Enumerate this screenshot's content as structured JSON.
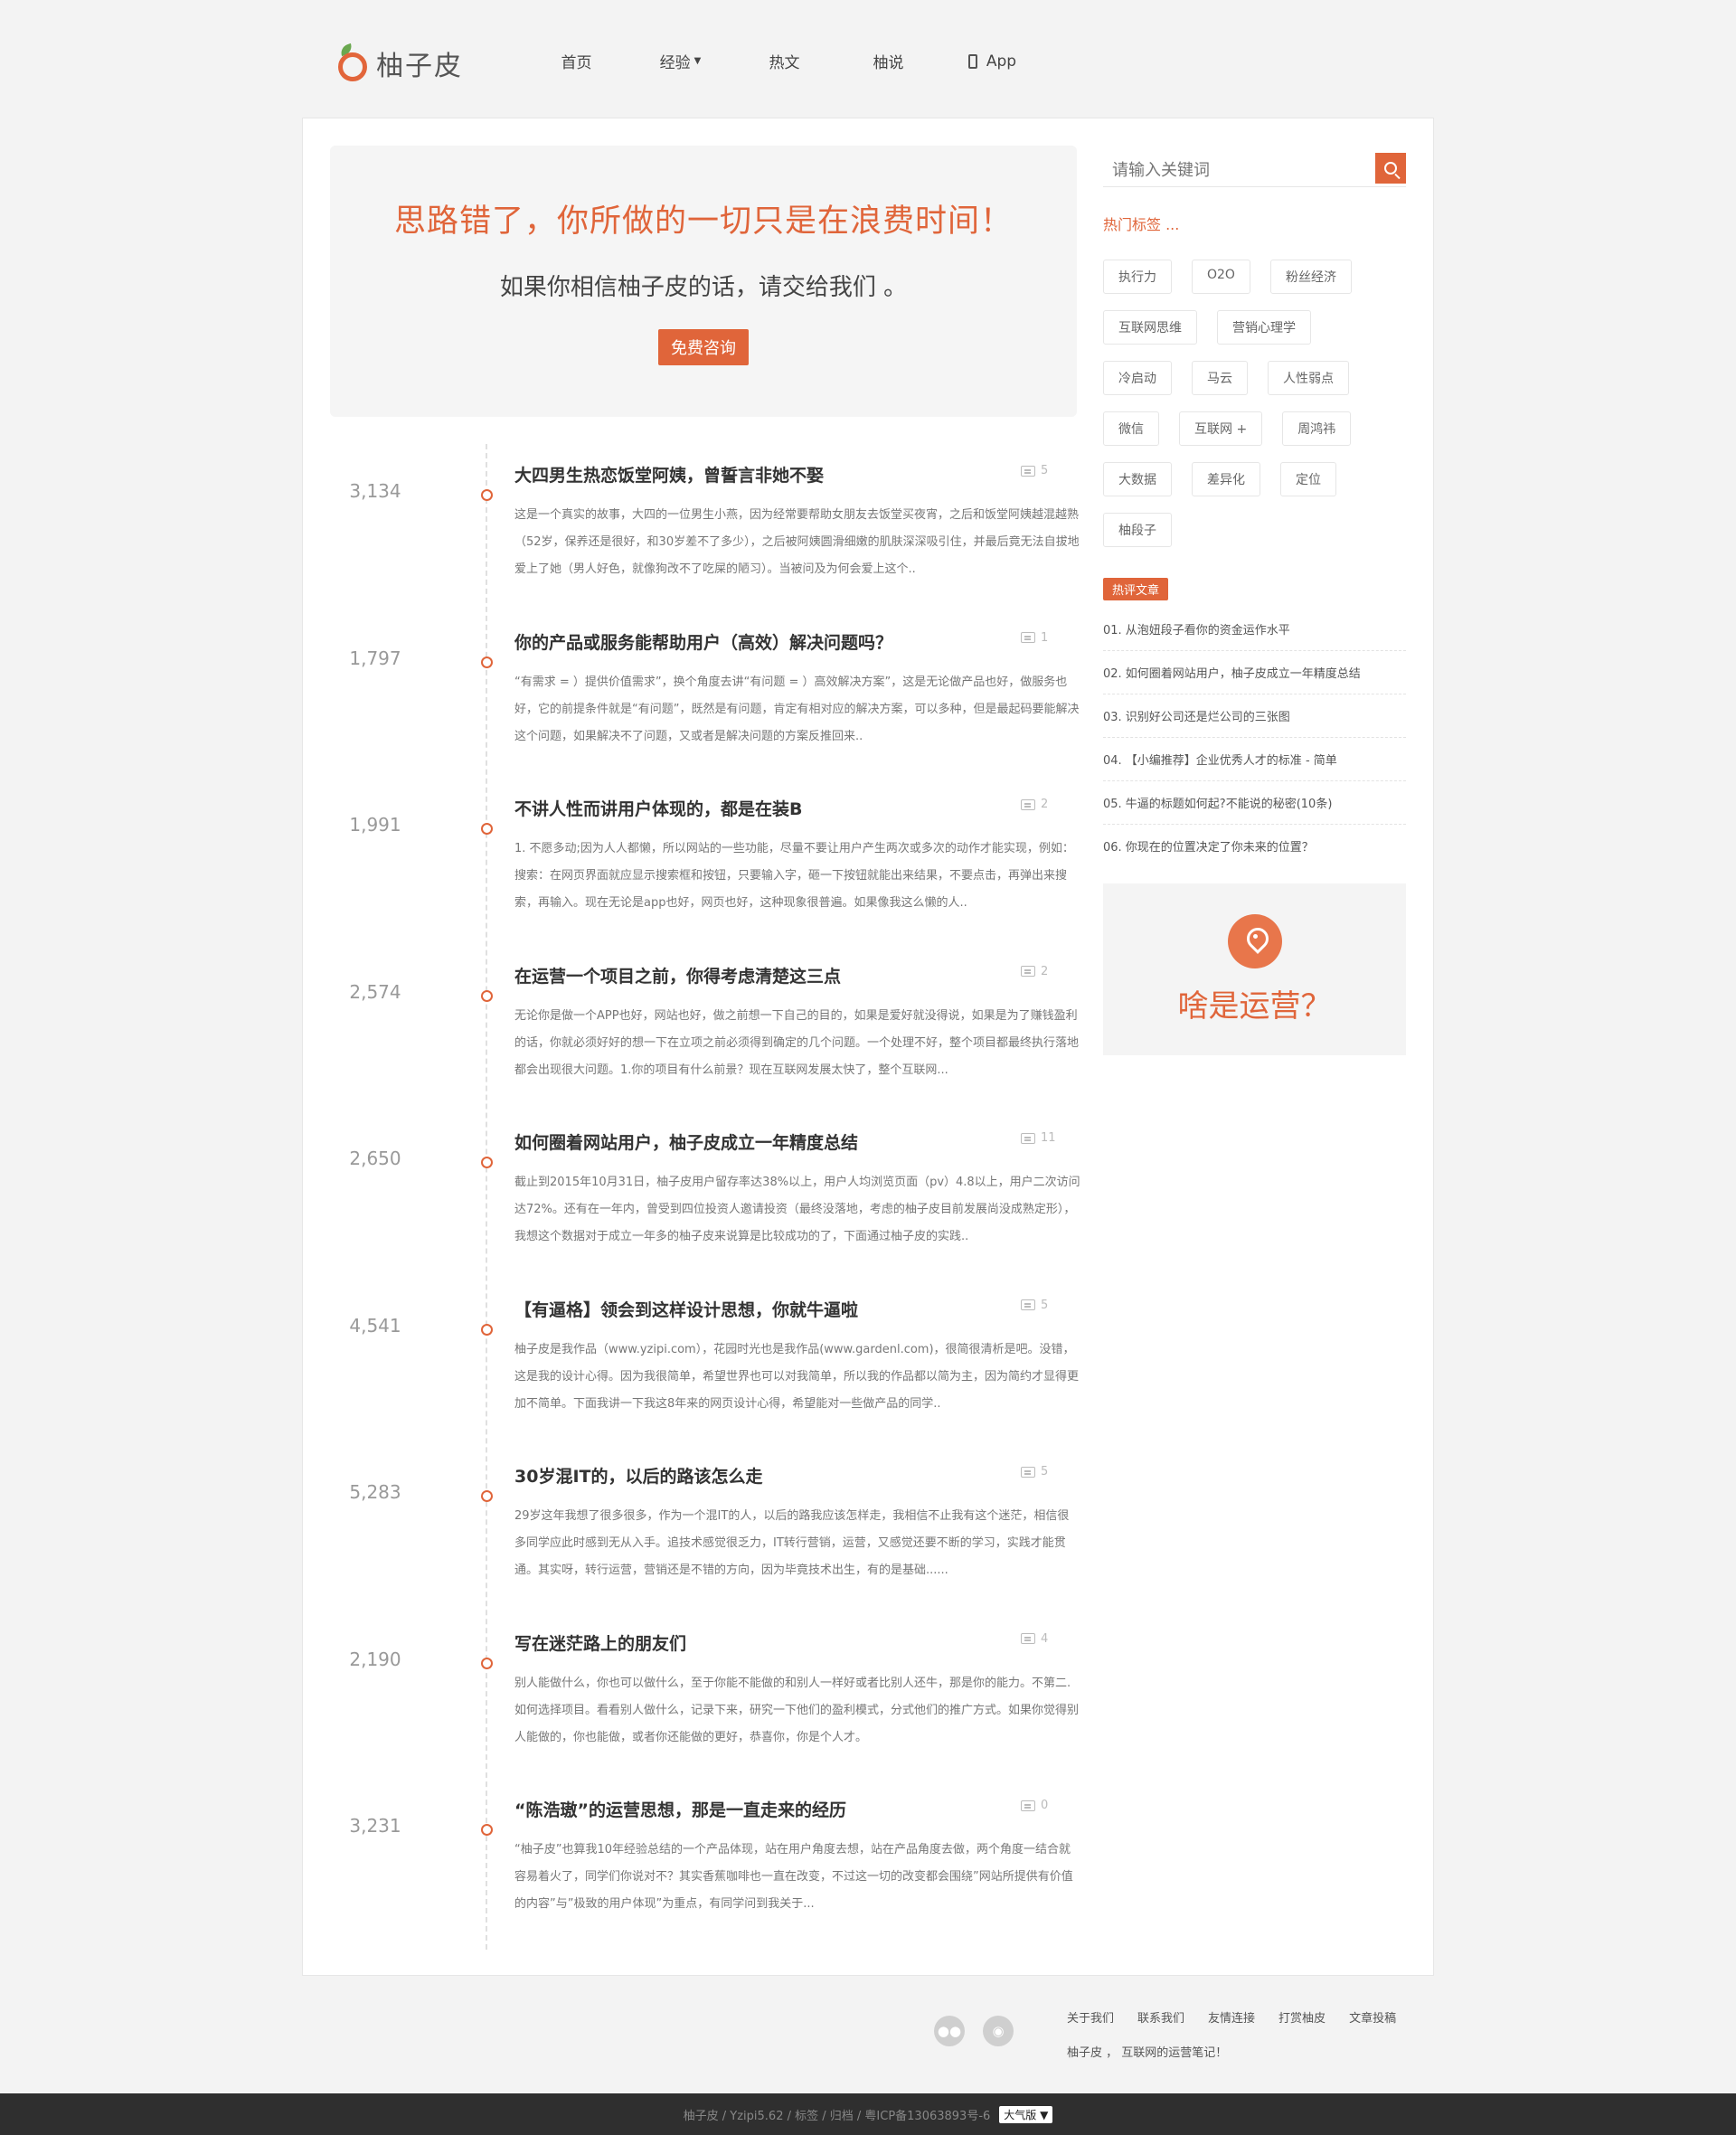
{
  "header": {
    "logo_text": "柚子皮",
    "nav": [
      "首页",
      "经验",
      "热文",
      "柚说",
      "App"
    ]
  },
  "hero": {
    "title": "思路错了，你所做的一切只是在浪费时间！",
    "subtitle": "如果你相信柚子皮的话，请交给我们 。",
    "button": "免费咨询"
  },
  "posts": [
    {
      "count": "3,134",
      "title": "大四男生热恋饭堂阿姨，曾誓言非她不娶",
      "comments": "5",
      "excerpt": "这是一个真实的故事，大四的一位男生小燕，因为经常要帮助女朋友去饭堂买夜宵，之后和饭堂阿姨越混越熟（52岁，保养还是很好，和30岁差不了多少），之后被阿姨圆滑细嫩的肌肤深深吸引住，并最后竟无法自拔地爱上了她（男人好色，就像狗改不了吃屎的陋习）。当被问及为何会爱上这个.."
    },
    {
      "count": "1,797",
      "title": "你的产品或服务能帮助用户（高效）解决问题吗？",
      "comments": "1",
      "excerpt": "“有需求 = ）提供价值需求”，换个角度去讲“有问题 = ）高效解决方案”，这是无论做产品也好，做服务也好，它的前提条件就是“有问题”，既然是有问题，肯定有相对应的解决方案，可以多种，但是最起码要能解决这个问题，如果解决不了问题，又或者是解决问题的方案反推回来.."
    },
    {
      "count": "1,991",
      "title": "不讲人性而讲用户体现的，都是在装B",
      "comments": "2",
      "excerpt": "1. 不愿多动;因为人人都懒，所以网站的一些功能，尽量不要让用户产生两次或多次的动作才能实现，例如：搜索：在网页界面就应显示搜索框和按钮，只要输入字，砸一下按钮就能出来结果，不要点击，再弹出来搜索，再输入。现在无论是app也好，网页也好，这种现象很普遍。如果像我这么懒的人.."
    },
    {
      "count": "2,574",
      "title": "在运营一个项目之前，你得考虑清楚这三点",
      "comments": "2",
      "excerpt": "无论你是做一个APP也好，网站也好，做之前想一下自己的目的，如果是爱好就没得说，如果是为了赚钱盈利的话，你就必须好好的想一下在立项之前必须得到确定的几个问题。一个处理不好，整个项目都最终执行落地都会出现很大问题。1.你的项目有什么前景？现在互联网发展太快了，整个互联网..."
    },
    {
      "count": "2,650",
      "title": "如何圈着网站用户，柚子皮成立一年精度总结",
      "comments": "11",
      "excerpt": "截止到2015年10月31日，柚子皮用户留存率达38%以上，用户人均浏览页面（pv）4.8以上，用户二次访问达72%。还有在一年内，曾受到四位投资人邀请投资（最终没落地，考虑的柚子皮目前发展尚没成熟定形），我想这个数据对于成立一年多的柚子皮来说算是比较成功的了，下面通过柚子皮的实践.."
    },
    {
      "count": "4,541",
      "title": "【有逼格】领会到这样设计思想，你就牛逼啦",
      "comments": "5",
      "excerpt": "柚子皮是我作品（www.yzipi.com），花园时光也是我作品(www.gardenl.com)，很简很清析是吧。没错，这是我的设计心得。因为我很简单，希望世界也可以对我简单，所以我的作品都以简为主，因为简约才显得更加不简单。下面我讲一下我这8年来的网页设计心得，希望能对一些做产品的同学.."
    },
    {
      "count": "5,283",
      "title": "30岁混IT的，以后的路该怎么走",
      "comments": "5",
      "excerpt": "29岁这年我想了很多很多，作为一个混IT的人，以后的路我应该怎样走，我相信不止我有这个迷茫，相信很多同学应此时感到无从入手。追技术感觉很乏力，IT转行营销，运营，又感觉还要不断的学习，实践才能贯通。其实呀，转行运营，营销还是不错的方向，因为毕竟技术出生，有的是基础......"
    },
    {
      "count": "2,190",
      "title": "写在迷茫路上的朋友们",
      "comments": "4",
      "excerpt": "别人能做什么，你也可以做什么，至于你能不能做的和别人一样好或者比别人还牛，那是你的能力。不第二.如何选择项目。看看别人做什么，记录下来，研究一下他们的盈利模式，分式他们的推广方式。如果你觉得别人能做的，你也能做，或者你还能做的更好，恭喜你，你是个人才。"
    },
    {
      "count": "3,231",
      "title": "“陈浩璈”的运营思想，那是一直走来的经历",
      "comments": "0",
      "excerpt": "“柚子皮”也算我10年经验总结的一个产品体现，站在用户角度去想，站在产品角度去做，两个角度一结合就容易着火了，同学们你说对不？其实香蕉咖啡也一直在改变，不过这一切的改变都会围绕”网站所提供有价值的内容”与”极致的用户体现”为重点，有同学问到我关于..."
    }
  ],
  "sidebar": {
    "search_placeholder": "请输入关键词",
    "hot_tags_title": "热门标签 ...",
    "tag_rows": [
      [
        "执行力",
        "O2O",
        "粉丝经济"
      ],
      [
        "互联网思维",
        "营销心理学"
      ],
      [
        "冷启动",
        "马云",
        "人性弱点"
      ],
      [
        "微信",
        "互联网 +",
        "周鸿祎"
      ],
      [
        "大数据",
        "差异化",
        "定位"
      ],
      [
        "柚段子"
      ]
    ],
    "hot_articles_title": "热评文章",
    "hot_articles": [
      "01.  从泡妞段子看你的资金运作水平",
      "02.  如何圈着网站用户，柚子皮成立一年精度总结",
      "03.  识别好公司还是烂公司的三张图",
      "04.  【小编推荐】企业优秀人才的标准 - 简单",
      "05.  牛逼的标题如何起?不能说的秘密(10条)",
      "06.  你现在的位置决定了你未来的位置？"
    ],
    "promo_text": "啥是运营？"
  },
  "footer": {
    "links": [
      "关于我们",
      "联系我们",
      "友情连接",
      "打赏柚皮",
      "文章投稿"
    ],
    "slogan": "柚子皮 ， 互联网的运营笔记！",
    "bottom_text": "柚子皮 / Yzipi5.62 / 标签 / 归档 / 粤ICP备13063893号-6",
    "theme": "大气版 ▼"
  }
}
